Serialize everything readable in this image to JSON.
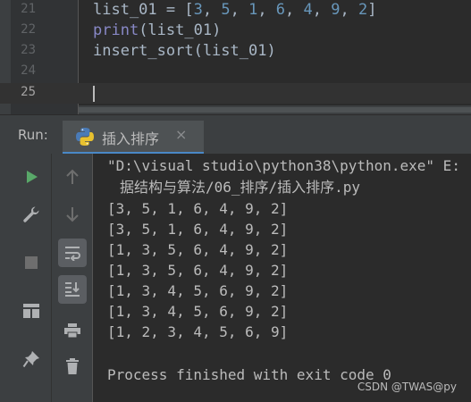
{
  "editor": {
    "lines": [
      {
        "number": "21",
        "code_prefix": "list_01 = [",
        "nums": [
          "3",
          "5",
          "1",
          "6",
          "4",
          "9",
          "2"
        ],
        "code_suffix": "]"
      },
      {
        "number": "22",
        "builtin": "print",
        "code": "(list_01)"
      },
      {
        "number": "23",
        "code": "insert_sort(list_01)"
      },
      {
        "number": "24",
        "code": ""
      },
      {
        "number": "25",
        "code": ""
      }
    ]
  },
  "run": {
    "label": "Run:",
    "tab_label": "插入排序",
    "close_glyph": "×"
  },
  "console": {
    "command_line1": "\"D:\\visual studio\\python38\\python.exe\" E:",
    "command_line2": "据结构与算法/06_排序/插入排序.py",
    "outputs": [
      "[3, 5, 1, 6, 4, 9, 2]",
      "[3, 5, 1, 6, 4, 9, 2]",
      "[1, 3, 5, 6, 4, 9, 2]",
      "[1, 3, 5, 6, 4, 9, 2]",
      "[1, 3, 4, 5, 6, 9, 2]",
      "[1, 3, 4, 5, 6, 9, 2]",
      "[1, 2, 3, 4, 5, 6, 9]"
    ],
    "exit_message": "Process finished with exit code 0"
  },
  "watermark": "CSDN @TWAS@py",
  "toolbar": {
    "col1": [
      "run-icon",
      "wrench-icon",
      "stop-icon",
      "layout-icon",
      "pin-icon"
    ],
    "col2": [
      "up-arrow-icon",
      "down-arrow-icon",
      "soft-wrap-icon",
      "scroll-to-end-icon",
      "print-icon",
      "trash-icon"
    ]
  },
  "colors": {
    "run_green": "#59a869",
    "number_blue": "#6897bb",
    "builtin_purple": "#8888c6",
    "tab_underline": "#4a88c7"
  }
}
